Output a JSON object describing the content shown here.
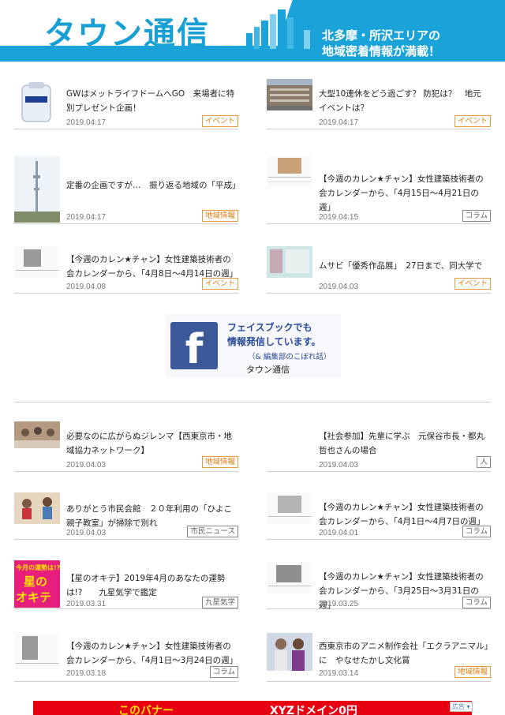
{
  "header": {
    "logo": "タウン通信",
    "tagline_1": "北多摩・所沢エリアの",
    "tagline_2": "地域密着情報が満載！"
  },
  "articles": [
    {
      "title": "GWはメットライフドームへGO　来場者に特別プレゼント企画！",
      "date": "2019.04.17",
      "category": "イベント",
      "thumb": "baseball-bag-image"
    },
    {
      "title": "大型10連休をどう過ごす？ 防犯は？　地元イベントは？",
      "date": "2019.04.17",
      "category": "イベント",
      "thumb": "station-building-image"
    },
    {
      "title": "定番の企画ですが…　振り返る地域の「平成」",
      "date": "2019.04.17",
      "category": "地域情報",
      "thumb": "tower-image"
    },
    {
      "title": "【今週のカレン★チャン】女性建築技術者の会カレンダーから、「4月15日～4月21日の週」",
      "date": "2019.04.15",
      "category": "コラム",
      "thumb": "calendar-image"
    },
    {
      "title": "【今週のカレン★チャン】女性建築技術者の会カレンダーから、「4月8日～4月14日の週」",
      "date": "2019.04.08",
      "category": "イベント",
      "thumb": "calendar-image"
    },
    {
      "title": "ムサビ「優秀作品展」　27日まで、同大学で",
      "date": "2019.04.03",
      "category": "イベント",
      "thumb": "exhibition-image"
    },
    {
      "title": "必要なのに広がらぬジレンマ【西東京市・地域協力ネットワーク】",
      "date": "2019.04.03",
      "category": "地域情報",
      "thumb": "meeting-image"
    },
    {
      "title": "【社会参加】先輩に学ぶ　元保谷市長・都丸哲也さんの場合",
      "date": "2019.04.03",
      "category": "人",
      "thumb": ""
    },
    {
      "title": "ありがとう市民会館　２０年利用の「ひよこ親子教室」が掃除で別れ",
      "date": "2019.04.03",
      "category": "市民ニュース",
      "thumb": "children-image"
    },
    {
      "title": "【今週のカレン★チャン】女性建築技術者の会カレンダーから、「4月1日～4月7日の週」",
      "date": "2019.04.01",
      "category": "コラム",
      "thumb": "calendar-image"
    },
    {
      "title": "【星のオキテ】2019年4月のあなたの運勢は!?　　九星気学で鑑定",
      "date": "2019.03.31",
      "category": "九星気学",
      "thumb": "horoscope-image"
    },
    {
      "title": "【今週のカレン★チャン】女性建築技術者の会カレンダーから、「3月25日～3月31日の週」",
      "date": "2019.03.25",
      "category": "コラム",
      "thumb": "calendar-image"
    },
    {
      "title": "【今週のカレン★チャン】女性建築技術者の会カレンダーから、「4月1日～3月24日の週」",
      "date": "2019.03.18",
      "category": "コラム",
      "thumb": "calendar-image"
    },
    {
      "title": "西東京市のアニメ制作会社「エクラアニマル」に　やなせたかし文化賞",
      "date": "2019.03.14",
      "category": "地域情報",
      "thumb": "award-image"
    }
  ],
  "horoscope_thumb": {
    "line1": "今月の運勢は!?",
    "line2": "星の",
    "line3": "オキテ"
  },
  "facebook_banner": {
    "icon": "f",
    "line1": "フェイスブックでも",
    "line2": "情報発信しています。",
    "line3": "（& 編集部のこぼれ話）",
    "line4": "タウン通信"
  },
  "ad": {
    "text1": "このバナー",
    "text2": "XYZドメイン0円",
    "label": "広告 ▾"
  },
  "colors": {
    "brand": "#1aa3d8",
    "event_badge": "#e07d10",
    "facebook": "#3b5998",
    "ad": "#e60012"
  }
}
